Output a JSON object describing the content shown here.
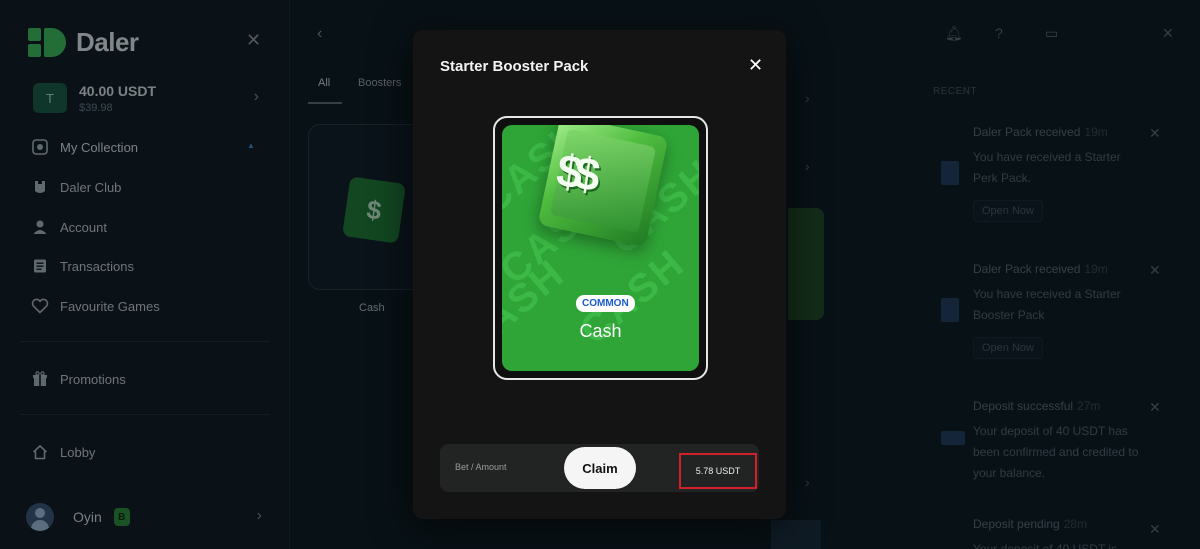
{
  "brand": {
    "name": "Daler"
  },
  "wallet": {
    "badge": "T",
    "amount": "40.00 USDT",
    "sub": "$39.98"
  },
  "nav": [
    {
      "label": "My Collection"
    },
    {
      "label": "Daler Club"
    },
    {
      "label": "Account"
    },
    {
      "label": "Transactions"
    },
    {
      "label": "Favourite Games"
    },
    {
      "label": "Promotions"
    },
    {
      "label": "Lobby"
    }
  ],
  "user": {
    "name": "Oyin",
    "tag": "B"
  },
  "main": {
    "tabs": [
      "All",
      "Boosters"
    ],
    "card_label": "Cash"
  },
  "notifications": {
    "heading": "RECENT",
    "items": [
      {
        "title": "Daler Pack received",
        "time": "19m",
        "body": "You have received a Starter Perk Pack.",
        "action": "Open Now"
      },
      {
        "title": "Daler Pack received",
        "time": "19m",
        "body": "You have received a Starter Booster Pack",
        "action": "Open Now"
      },
      {
        "title": "Deposit successful",
        "time": "27m",
        "body": "Your deposit of 40 USDT has been confirmed and credited to your balance."
      },
      {
        "title": "Deposit pending",
        "time": "28m",
        "body": "Your deposit of 40 USDT is"
      }
    ]
  },
  "modal": {
    "title": "Starter Booster Pack",
    "rarity": "COMMON",
    "pack_name": "Cash",
    "dollar": "$$",
    "pattern_text": "CASH",
    "bet_label": "Bet / Amount",
    "claim_label": "Claim",
    "amount": "5.78 USDT"
  },
  "colors": {
    "brand_green": "#3fbf5a",
    "pack_green": "#2fa537",
    "rarity_blue": "#1a5ccc",
    "highlight_red": "#d0202a"
  }
}
